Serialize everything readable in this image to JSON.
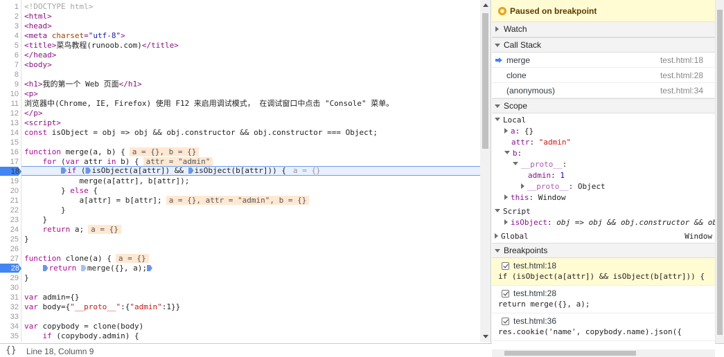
{
  "editor": {
    "lines": [
      {
        "n": "1",
        "parts": [
          {
            "t": "<!DOCTYPE html>",
            "c": "dt"
          }
        ]
      },
      {
        "n": "2",
        "parts": [
          {
            "t": "<html>",
            "c": "tg"
          }
        ]
      },
      {
        "n": "3",
        "parts": [
          {
            "t": "<head>",
            "c": "tg"
          }
        ]
      },
      {
        "n": "4",
        "parts": [
          {
            "t": "<meta ",
            "c": "tg"
          },
          {
            "t": "charset",
            "c": "at"
          },
          {
            "t": "=",
            "c": "tg"
          },
          {
            "t": "\"utf-8\"",
            "c": "av"
          },
          {
            "t": ">",
            "c": "tg"
          }
        ]
      },
      {
        "n": "5",
        "parts": [
          {
            "t": "<title>",
            "c": "tg"
          },
          {
            "t": "菜鸟教程(runoob.com)",
            "c": "pl"
          },
          {
            "t": "</title>",
            "c": "tg"
          }
        ]
      },
      {
        "n": "6",
        "parts": [
          {
            "t": "</head>",
            "c": "tg"
          }
        ]
      },
      {
        "n": "7",
        "parts": [
          {
            "t": "<body>",
            "c": "tg"
          }
        ]
      },
      {
        "n": "8",
        "parts": []
      },
      {
        "n": "9",
        "parts": [
          {
            "t": "<h1>",
            "c": "tg"
          },
          {
            "t": "我的第一个 Web 页面",
            "c": "pl"
          },
          {
            "t": "</h1>",
            "c": "tg"
          }
        ]
      },
      {
        "n": "10",
        "parts": [
          {
            "t": "<p>",
            "c": "tg"
          }
        ]
      },
      {
        "n": "11",
        "parts": [
          {
            "t": "浏览器中(Chrome, IE, Firefox) 使用 F12 来启用调试模式， 在调试窗口中点击 \"Console\" 菜单。",
            "c": "pl"
          }
        ]
      },
      {
        "n": "12",
        "parts": [
          {
            "t": "</p>",
            "c": "tg"
          }
        ]
      },
      {
        "n": "13",
        "parts": [
          {
            "t": "<script>",
            "c": "tg"
          }
        ]
      },
      {
        "n": "14",
        "parts": [
          {
            "t": "const ",
            "c": "kw"
          },
          {
            "t": "isObject = obj => obj && obj.constructor && obj.constructor === Object;",
            "c": "pl"
          }
        ]
      },
      {
        "n": "15",
        "parts": []
      },
      {
        "n": "16",
        "parts": [
          {
            "t": "function ",
            "c": "kw"
          },
          {
            "t": "merge(a, b) {",
            "c": "pl"
          },
          {
            "t": "a = {}, b = {}",
            "c": "iv"
          }
        ]
      },
      {
        "n": "17",
        "parts": [
          {
            "t": "    for ",
            "c": "kw"
          },
          {
            "t": "(",
            "c": "pl"
          },
          {
            "t": "var ",
            "c": "kw"
          },
          {
            "t": "attr ",
            "c": "pl"
          },
          {
            "t": "in ",
            "c": "kw"
          },
          {
            "t": "b) {",
            "c": "pl"
          },
          {
            "t": "attr = \"admin\"",
            "c": "iv"
          }
        ]
      },
      {
        "n": "18",
        "parts": [
          {
            "t": "        ",
            "c": "pl"
          },
          {
            "t": "",
            "c": "bm"
          },
          {
            "t": "if",
            "c": "kw"
          },
          {
            "t": " (",
            "c": "pl"
          },
          {
            "t": "",
            "c": "bm"
          },
          {
            "t": "isObject(a[attr]) && ",
            "c": "pl"
          },
          {
            "t": "",
            "c": "bm"
          },
          {
            "t": "isObject(b[attr])) {",
            "c": "pl"
          },
          {
            "t": "a = {}",
            "c": "iv hv"
          }
        ],
        "hl": true
      },
      {
        "n": "19",
        "parts": [
          {
            "t": "            merge(a[attr], b[attr]);",
            "c": "pl"
          }
        ]
      },
      {
        "n": "20",
        "parts": [
          {
            "t": "        } ",
            "c": "pl"
          },
          {
            "t": "else ",
            "c": "kw"
          },
          {
            "t": "{",
            "c": "pl"
          }
        ]
      },
      {
        "n": "21",
        "parts": [
          {
            "t": "            a[attr] = b[attr];",
            "c": "pl"
          },
          {
            "t": "a = {}, attr = \"admin\", b = {}",
            "c": "iv"
          }
        ]
      },
      {
        "n": "22",
        "parts": [
          {
            "t": "        }",
            "c": "pl"
          }
        ]
      },
      {
        "n": "23",
        "parts": [
          {
            "t": "    }",
            "c": "pl"
          }
        ]
      },
      {
        "n": "24",
        "parts": [
          {
            "t": "    return ",
            "c": "kw"
          },
          {
            "t": "a;",
            "c": "pl"
          },
          {
            "t": "a = {}",
            "c": "iv"
          }
        ]
      },
      {
        "n": "25",
        "parts": [
          {
            "t": "}",
            "c": "pl"
          }
        ]
      },
      {
        "n": "26",
        "parts": []
      },
      {
        "n": "27",
        "parts": [
          {
            "t": "function ",
            "c": "kw"
          },
          {
            "t": "clone(a) {",
            "c": "pl"
          },
          {
            "t": "a = {}",
            "c": "iv"
          }
        ]
      },
      {
        "n": "28",
        "parts": [
          {
            "t": "    ",
            "c": "pl"
          },
          {
            "t": "",
            "c": "bm"
          },
          {
            "t": "return ",
            "c": "kw"
          },
          {
            "t": "",
            "c": "bm g"
          },
          {
            "t": "merge({}, a);",
            "c": "pl"
          },
          {
            "t": "",
            "c": "bm"
          }
        ]
      },
      {
        "n": "29",
        "parts": [
          {
            "t": "}",
            "c": "pl"
          }
        ]
      },
      {
        "n": "30",
        "parts": []
      },
      {
        "n": "31",
        "parts": [
          {
            "t": "var ",
            "c": "kw"
          },
          {
            "t": "admin={}",
            "c": "pl"
          }
        ]
      },
      {
        "n": "32",
        "parts": [
          {
            "t": "var ",
            "c": "kw"
          },
          {
            "t": "body={",
            "c": "pl"
          },
          {
            "t": "\"__proto__\"",
            "c": "str"
          },
          {
            "t": ":{",
            "c": "pl"
          },
          {
            "t": "\"admin\"",
            "c": "str"
          },
          {
            "t": ":1}}",
            "c": "pl"
          }
        ]
      },
      {
        "n": "33",
        "parts": []
      },
      {
        "n": "34",
        "parts": [
          {
            "t": "var ",
            "c": "kw"
          },
          {
            "t": "copybody = clone(body)",
            "c": "pl"
          }
        ]
      },
      {
        "n": "35",
        "parts": [
          {
            "t": "    if ",
            "c": "kw"
          },
          {
            "t": "(copybody.admin) {",
            "c": "pl"
          }
        ]
      }
    ],
    "breakpoint_lines": [
      "18",
      "28"
    ]
  },
  "status": {
    "brace_icon": "{}",
    "position": "Line 18, Column 9"
  },
  "sidebar": {
    "paused": "Paused on breakpoint",
    "watch": "Watch",
    "call_stack": "Call Stack",
    "frames": [
      {
        "name": "merge",
        "loc": "test.html:18",
        "current": true
      },
      {
        "name": "clone",
        "loc": "test.html:28",
        "current": false
      },
      {
        "name": "(anonymous)",
        "loc": "test.html:34",
        "current": false
      }
    ],
    "scope": "Scope",
    "scope_tree": {
      "local": "Local",
      "a_key": "a",
      "a_val": "{}",
      "attr_key": "attr",
      "attr_val": "\"admin\"",
      "b_key": "b",
      "proto_key": "__proto__",
      "admin_key": "admin",
      "admin_val": "1",
      "proto2_key": "__proto__",
      "proto2_val": "Object",
      "this_key": "this",
      "this_val": "Window",
      "script": "Script",
      "isobj_key": "isObject",
      "isobj_val": "obj => obj && obj.constructor && obj.co",
      "global": "Global",
      "global_val": "Window"
    },
    "breakpoints_title": "Breakpoints",
    "breakpoints": [
      {
        "label": "test.html:18",
        "code": "if (isObject(a[attr]) && isObject(b[attr])) {",
        "active": true
      },
      {
        "label": "test.html:28",
        "code": "return merge({}, a);",
        "active": false
      },
      {
        "label": "test.html:36",
        "code": "res.cookie('name', copybody.name).json({",
        "active": false
      }
    ]
  }
}
